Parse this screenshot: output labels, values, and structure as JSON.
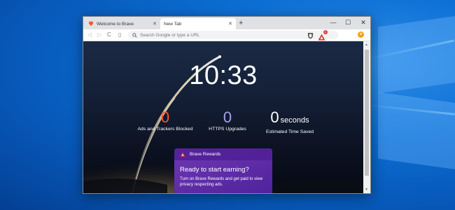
{
  "browser": {
    "tabs": [
      {
        "label": "Welcome to Brave",
        "active": false
      },
      {
        "label": "New Tab",
        "active": true
      }
    ],
    "new_tab_symbol": "+",
    "window_controls": {
      "minimize": "—",
      "maximize": "☐",
      "close": "✕"
    },
    "toolbar": {
      "back": "◁",
      "forward": "▷",
      "reload": "C",
      "bookmark": "▯",
      "search_placeholder": "Search Google or type a URL",
      "rewards_badge": "1"
    }
  },
  "new_tab_page": {
    "clock": "10:33",
    "stats": {
      "ads_blocked": {
        "value": "0",
        "label": "Ads and Trackers Blocked"
      },
      "https_upgrades": {
        "value": "0",
        "label": "HTTPS Upgrades"
      },
      "time_saved": {
        "value": "0",
        "unit": "seconds",
        "label": "Estimated Time Saved"
      }
    },
    "rewards_card": {
      "title": "Brave Rewards",
      "heading": "Ready to start earning?",
      "body": "Turn on Brave Rewards and get paid to view privacy respecting ads."
    }
  },
  "colors": {
    "ads_value": "#fb542b",
    "https_value": "#a0a5eb",
    "rewards_card": "#5b2aa4",
    "desktop": "#0c6fd4"
  }
}
